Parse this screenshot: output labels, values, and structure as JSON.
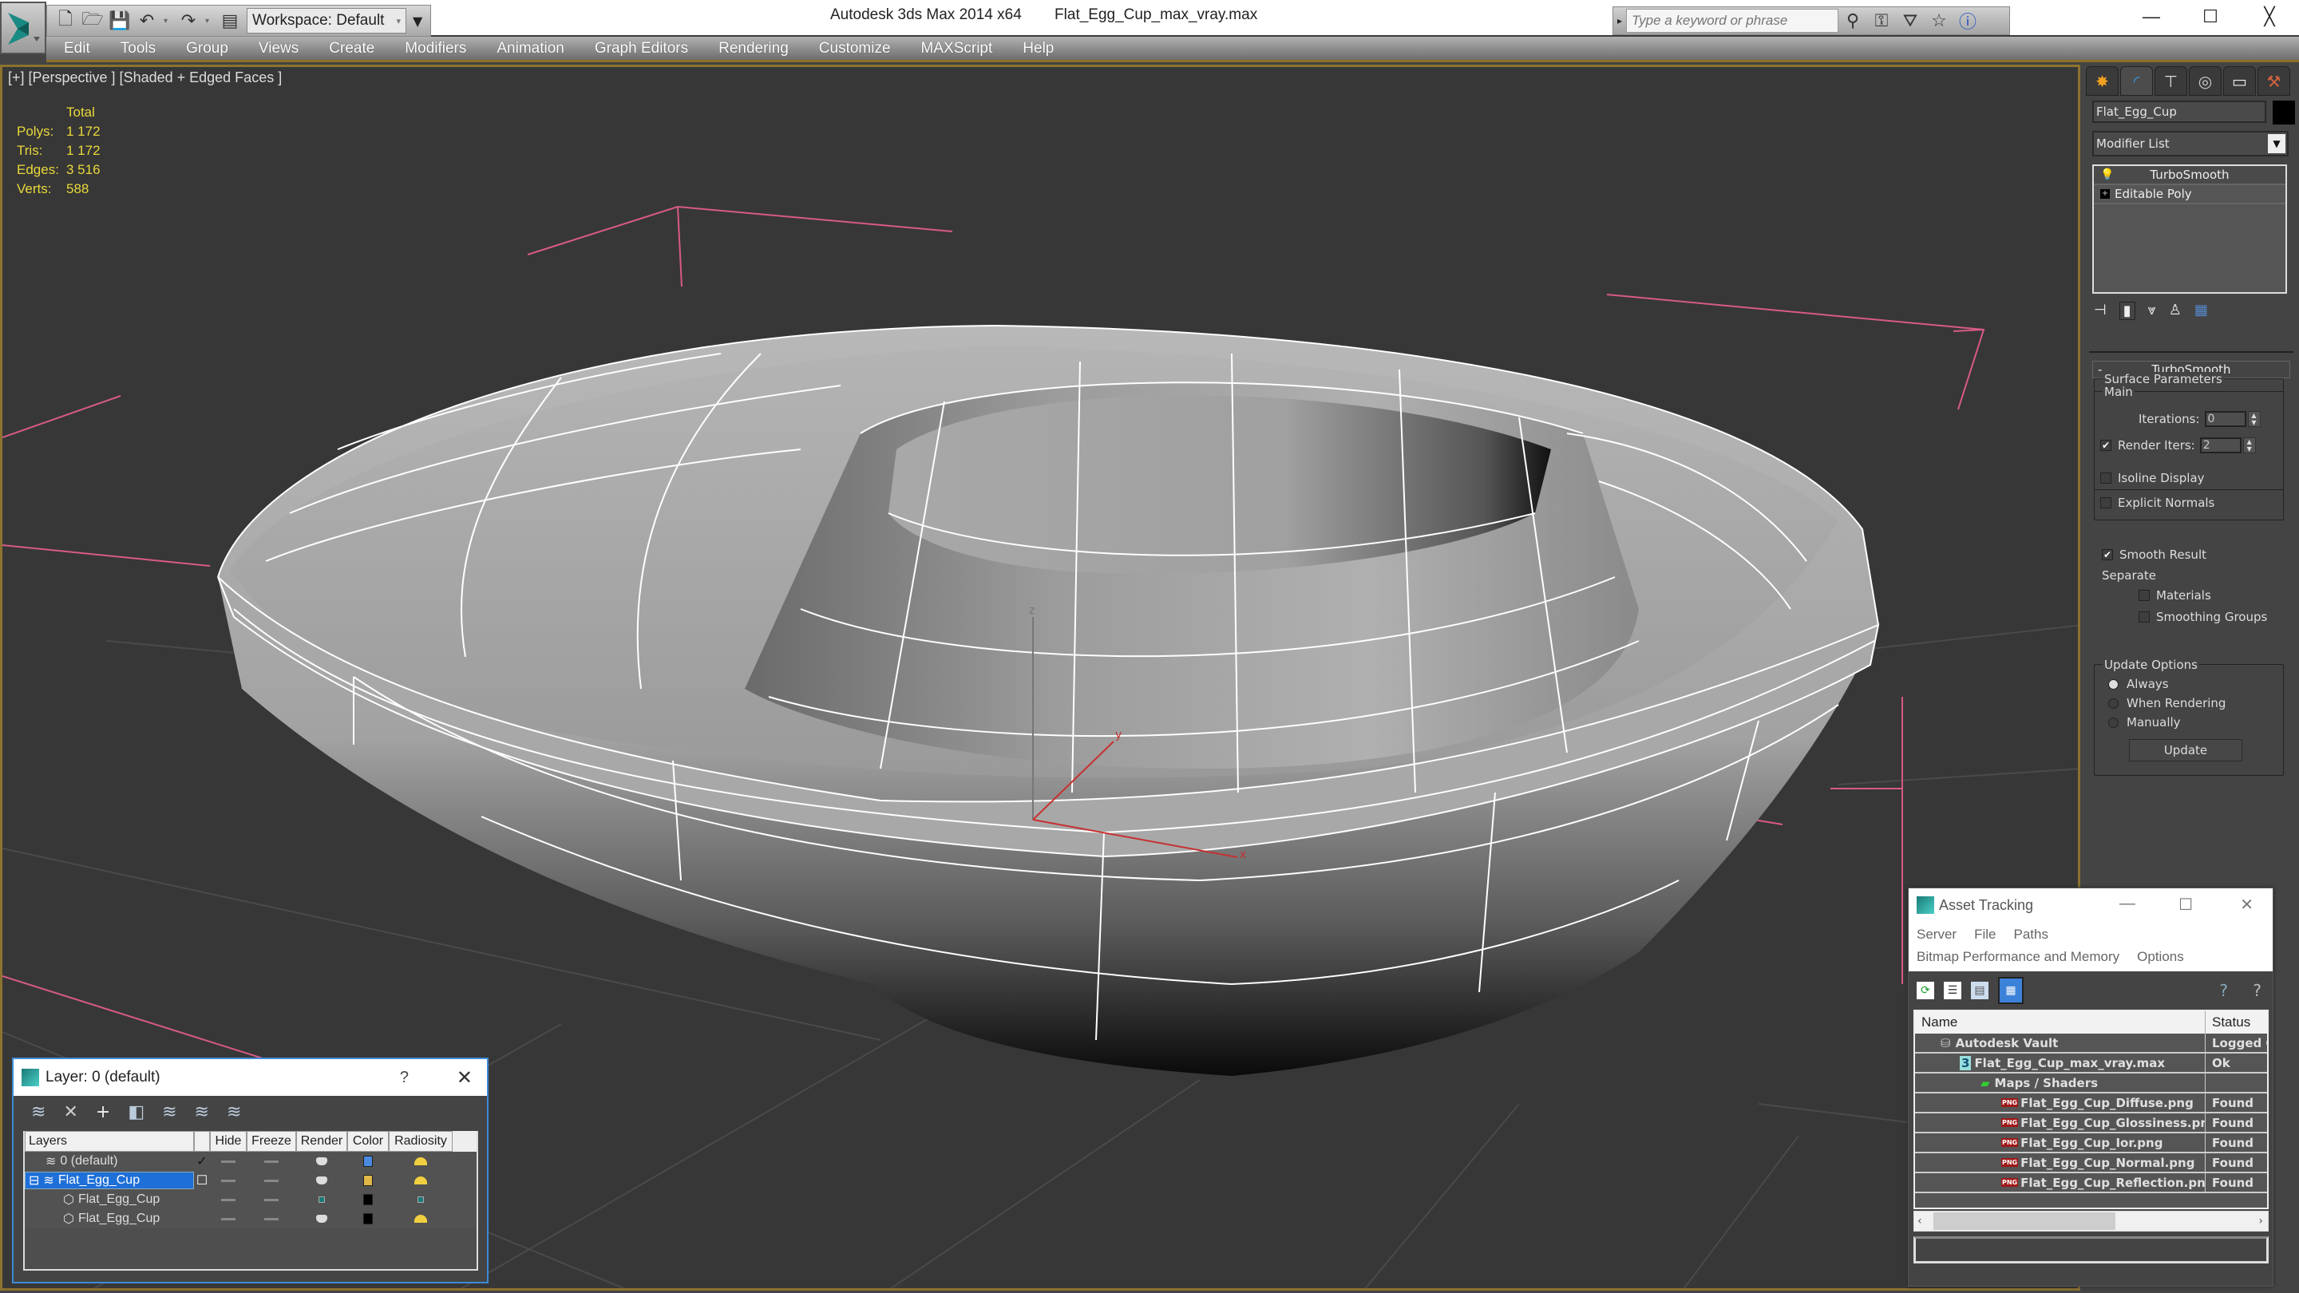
{
  "app": {
    "name": "Autodesk 3ds Max  2014 x64",
    "file": "Flat_Egg_Cup_max_vray.max"
  },
  "quick_access": {
    "workspace": "Workspace: Default",
    "icons": [
      "new-file-icon",
      "open-file-icon",
      "save-icon",
      "undo-icon",
      "redo-icon",
      "project-folder-icon"
    ]
  },
  "info_center": {
    "search_placeholder": "Type a keyword or phrase",
    "icons": [
      "binoculars-icon",
      "key-icon",
      "satellite-icon",
      "star-icon",
      "help-icon"
    ]
  },
  "window_controls": {
    "minimize": "—",
    "maximize": "☐",
    "close": "╳"
  },
  "menu": [
    "Edit",
    "Tools",
    "Group",
    "Views",
    "Create",
    "Modifiers",
    "Animation",
    "Graph Editors",
    "Rendering",
    "Customize",
    "MAXScript",
    "Help"
  ],
  "viewport": {
    "label": "[+] [Perspective ] [Shaded + Edged Faces ]",
    "stats": {
      "header": "Total",
      "rows": [
        {
          "k": "Polys:",
          "v": "1 172"
        },
        {
          "k": "Tris:",
          "v": "1 172"
        },
        {
          "k": "Edges:",
          "v": "3 516"
        },
        {
          "k": "Verts:",
          "v": "588"
        }
      ]
    },
    "axes": {
      "x": "x",
      "y": "y",
      "z": "z"
    }
  },
  "command_panel": {
    "tabs": [
      "create-tab",
      "modify-tab",
      "hierarchy-tab",
      "motion-tab",
      "display-tab",
      "utilities-tab"
    ],
    "object_name": "Flat_Egg_Cup",
    "object_color": "#000000",
    "modifier_list": "Modifier List",
    "stack": [
      "TurboSmooth",
      "Editable Poly"
    ],
    "turbosmooth": {
      "title": "TurboSmooth",
      "main_label": "Main",
      "iterations_label": "Iterations:",
      "iterations": "0",
      "render_iters_label": "Render Iters:",
      "render_iters": "2",
      "render_iters_checked": true,
      "isoline_label": "Isoline Display",
      "isoline_checked": false,
      "explicit_label": "Explicit Normals",
      "explicit_checked": false,
      "surface_label": "Surface Parameters",
      "smooth_result_label": "Smooth Result",
      "smooth_result_checked": true,
      "separate_label": "Separate",
      "materials_label": "Materials",
      "smoothing_groups_label": "Smoothing Groups",
      "update_options_label": "Update Options",
      "always_label": "Always",
      "when_rendering_label": "When Rendering",
      "manually_label": "Manually",
      "selected_update": "Always",
      "update_button": "Update"
    }
  },
  "layer_dialog": {
    "title": "Layer: 0 (default)",
    "help": "?",
    "close": "✕",
    "columns": [
      "Layers",
      "",
      "Hide",
      "Freeze",
      "Render",
      "Color",
      "Radiosity"
    ],
    "rows": [
      {
        "name": "0 (default)",
        "current": "✓",
        "color": "#4a8ae0",
        "render": "teapot",
        "radiosity": "sun",
        "level": 0,
        "selected": false
      },
      {
        "name": "Flat_Egg_Cup",
        "current": "☐",
        "color": "#e0b848",
        "render": "teapot",
        "radiosity": "sun",
        "level": 0,
        "selected": true
      },
      {
        "name": "Flat_Egg_Cup",
        "current": "",
        "color": "#000000",
        "render": "dot",
        "radiosity": "dot",
        "level": 1,
        "selected": false
      },
      {
        "name": "Flat_Egg_Cup",
        "current": "",
        "color": "#000000",
        "render": "teapot",
        "radiosity": "sun",
        "level": 1,
        "selected": false
      }
    ]
  },
  "asset_tracking": {
    "title": "Asset Tracking",
    "menu1": [
      "Server",
      "File",
      "Paths"
    ],
    "menu2": [
      "Bitmap Performance and Memory",
      "Options"
    ],
    "columns": [
      "Name",
      "Status"
    ],
    "rows": [
      {
        "name": "Autodesk Vault",
        "status": "Logged Out",
        "indent": 1,
        "icon": "vault-icon"
      },
      {
        "name": "Flat_Egg_Cup_max_vray.max",
        "status": "Ok",
        "indent": 2,
        "icon": "max-file-icon"
      },
      {
        "name": "Maps / Shaders",
        "status": "",
        "indent": 3,
        "icon": "maps-icon"
      },
      {
        "name": "Flat_Egg_Cup_Diffuse.png",
        "status": "Found",
        "indent": 4,
        "icon": "png-icon"
      },
      {
        "name": "Flat_Egg_Cup_Glossiness.png",
        "status": "Found",
        "indent": 4,
        "icon": "png-icon"
      },
      {
        "name": "Flat_Egg_Cup_Ior.png",
        "status": "Found",
        "indent": 4,
        "icon": "png-icon"
      },
      {
        "name": "Flat_Egg_Cup_Normal.png",
        "status": "Found",
        "indent": 4,
        "icon": "png-icon"
      },
      {
        "name": "Flat_Egg_Cup_Reflection.png",
        "status": "Found",
        "indent": 4,
        "icon": "png-icon"
      }
    ]
  }
}
